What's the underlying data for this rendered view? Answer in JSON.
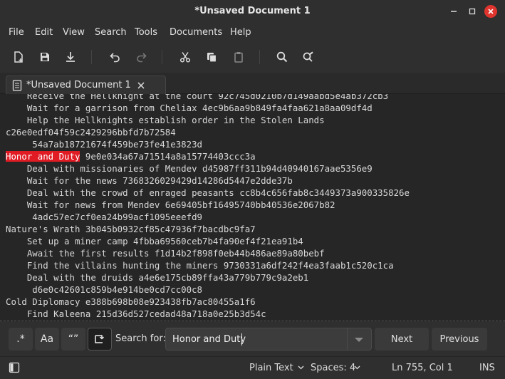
{
  "window": {
    "title": "*Unsaved Document 1"
  },
  "menu": [
    "File",
    "Edit",
    "View",
    "Search",
    "Tools",
    "Documents",
    "Help"
  ],
  "toolbar": {
    "icons": [
      "new-document-icon",
      "save-icon",
      "download-icon",
      "undo-icon",
      "redo-icon",
      "cut-icon",
      "copy-icon",
      "paste-icon",
      "search-icon",
      "replace-icon"
    ]
  },
  "tab": {
    "label": "*Unsaved Document 1"
  },
  "editor": {
    "lines": [
      "    Receive the Hellknight at the court 92c745d0210b7d149aabd5e4ab372cb3",
      "    Wait for a garrison from Cheliax 4ec9b6aa9b849fa4faa621a8aa09df4d",
      "    Help the Hellknights establish order in the Stolen Lands",
      "c26e0edf04f59c2429296bbfd7b72584",
      "     54a7ab18721674f459be73fe41e3823d",
      "Honor and Duty 9e0e034a67a71514a8a15774403ccc3a",
      "    Deal with missionaries of Mendev d45987ff311b94d40940167aae5356e9",
      "    Wait for the news 7368326029429d14286d5447e2dde37b",
      "    Deal with the crowd of enraged peasants cc8b4c656fab8c3449373a900335826e",
      "    Wait for news from Mendev 6e69405bf16495740bb40536e2067b82",
      "     4adc57ec7cf0ea24b99acf1095eeefd9",
      "Nature's Wrath 3b045b0932cf85c47936f7bacdbc9fa7",
      "    Set up a miner camp 4fbba69560ceb7b4fa90ef4f21ea91b4",
      "    Await the first results f1d14b2f898f0eb44b486ae89a80bebf",
      "    Find the villains hunting the miners 9730331a6df242f4ea3faab1c520c1ca",
      "    Deal with the druids a4e6e175cb89ffa43a779b779c9a2eb1",
      "     d6e0c42601c859b4e914be0cd7cc00c8",
      "Cold Diplomacy e388b698b08e923438fb7ac80455a1f6",
      "    Find Kaleena 215d36d527cedad48a718a0e25b3d54c"
    ],
    "highlight": "Honor and Duty",
    "highlight_line": 5
  },
  "search": {
    "regex_label": ".*",
    "case_label": "Aa",
    "quote_label": "“”",
    "label": "Search for:",
    "value": "Honor and Duty",
    "next_label": "Next",
    "previous_label": "Previous"
  },
  "status": {
    "syntax": "Plain Text",
    "spaces": "Spaces: 4",
    "position": "Ln 755, Col 1",
    "mode": "INS"
  }
}
